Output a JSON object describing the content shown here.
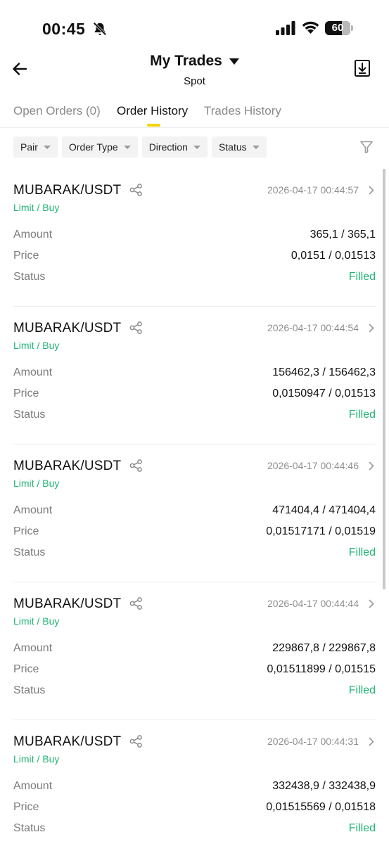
{
  "status_bar": {
    "time": "00:45",
    "battery": "60"
  },
  "header": {
    "title": "My Trades",
    "subtitle": "Spot"
  },
  "tabs": [
    {
      "label": "Open Orders (0)"
    },
    {
      "label": "Order History"
    },
    {
      "label": "Trades History"
    }
  ],
  "active_tab": "Order History",
  "filters": [
    {
      "label": "Pair"
    },
    {
      "label": "Order Type"
    },
    {
      "label": "Direction"
    },
    {
      "label": "Status"
    }
  ],
  "row_labels": {
    "amount": "Amount",
    "price": "Price",
    "status": "Status"
  },
  "orders": [
    {
      "pair": "MUBARAK/USDT",
      "time": "2026-04-17 00:44:57",
      "type": "Limit / Buy",
      "amount": "365,1 / 365,1",
      "price": "0,0151 / 0,01513",
      "status": "Filled"
    },
    {
      "pair": "MUBARAK/USDT",
      "time": "2026-04-17 00:44:54",
      "type": "Limit / Buy",
      "amount": "156462,3 / 156462,3",
      "price": "0,0150947 / 0,01513",
      "status": "Filled"
    },
    {
      "pair": "MUBARAK/USDT",
      "time": "2026-04-17 00:44:46",
      "type": "Limit / Buy",
      "amount": "471404,4 / 471404,4",
      "price": "0,01517171 / 0,01519",
      "status": "Filled"
    },
    {
      "pair": "MUBARAK/USDT",
      "time": "2026-04-17 00:44:44",
      "type": "Limit / Buy",
      "amount": "229867,8 / 229867,8",
      "price": "0,01511899 / 0,01515",
      "status": "Filled"
    },
    {
      "pair": "MUBARAK/USDT",
      "time": "2026-04-17 00:44:31",
      "type": "Limit / Buy",
      "amount": "332438,9 / 332438,9",
      "price": "0,01515569 / 0,01518",
      "status": "Filled"
    }
  ],
  "colors": {
    "accent_green": "#22b574",
    "tab_indicator": "#f5d400"
  },
  "icons": [
    "bell-muted-icon",
    "signal-icon",
    "wifi-icon",
    "battery-icon",
    "back-arrow-icon",
    "caret-down-icon",
    "download-icon",
    "filter-icon",
    "share-icon",
    "chevron-right-icon"
  ]
}
